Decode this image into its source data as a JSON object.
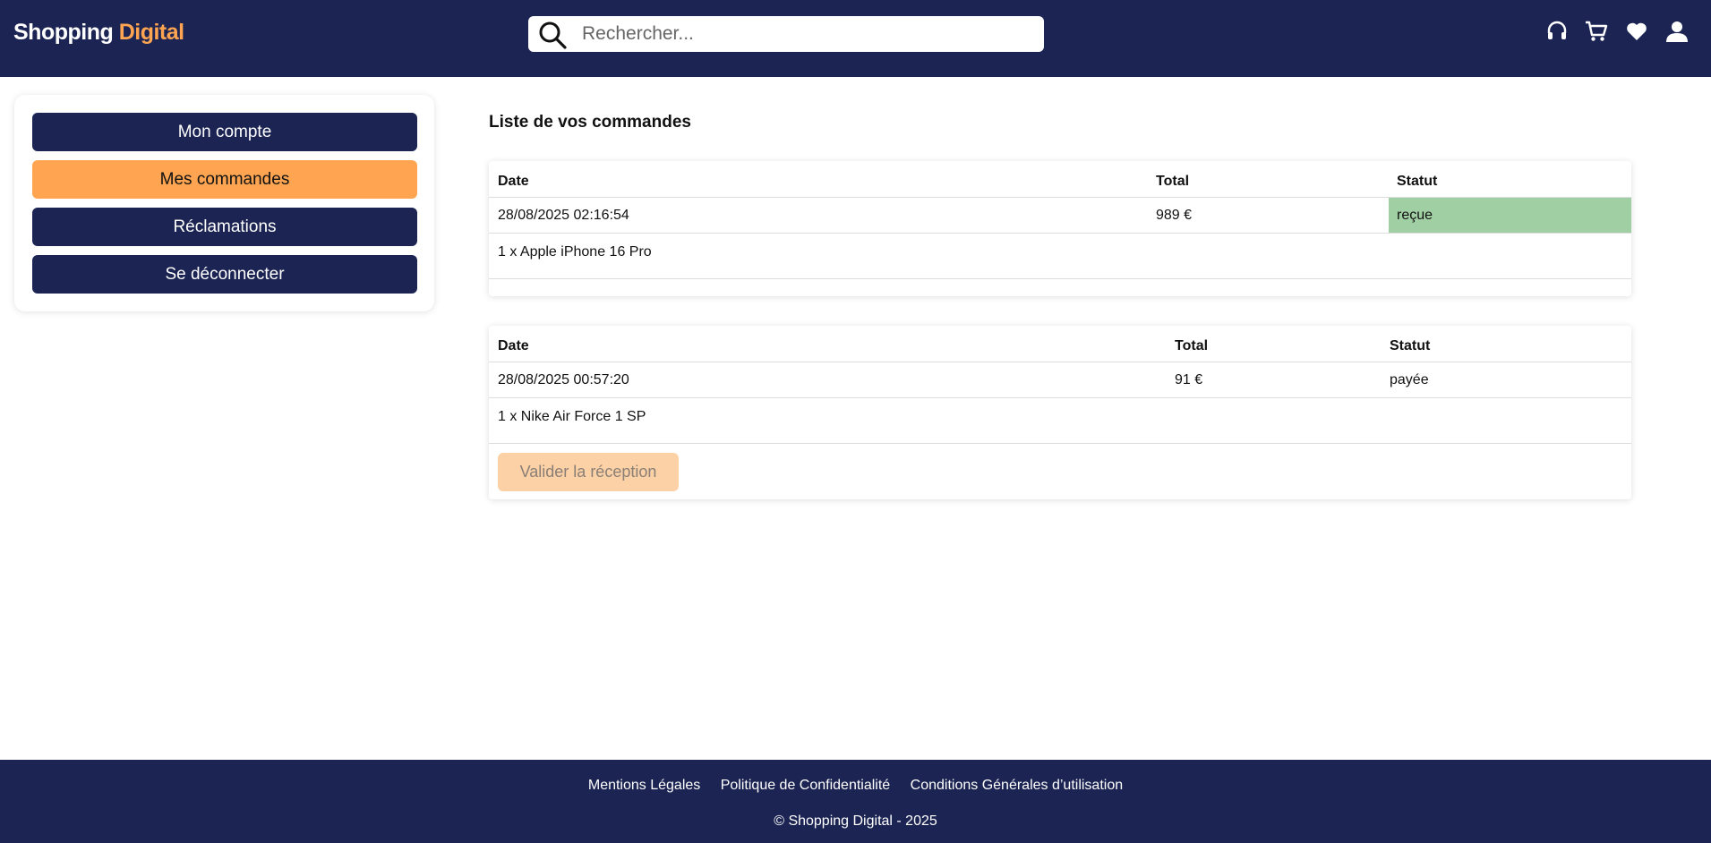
{
  "header": {
    "logo_main": "Shopping",
    "logo_accent": "Digital",
    "search_placeholder": "Rechercher...",
    "icons": [
      "headset-icon",
      "cart-icon",
      "heart-icon",
      "user-icon"
    ]
  },
  "sidebar": {
    "items": [
      {
        "label": "Mon compte",
        "active": false
      },
      {
        "label": "Mes commandes",
        "active": true
      },
      {
        "label": "Réclamations",
        "active": false
      },
      {
        "label": "Se déconnecter",
        "active": false
      }
    ]
  },
  "main": {
    "title": "Liste de vos commandes",
    "orders": [
      {
        "headers": {
          "date": "Date",
          "total": "Total",
          "status": "Statut"
        },
        "date": "28/08/2025 02:16:54",
        "total": "989 €",
        "status": "reçue",
        "status_color": "#a0cfa4",
        "items": "1 x Apple iPhone 16 Pro"
      },
      {
        "headers": {
          "date": "Date",
          "total": "Total",
          "status": "Statut"
        },
        "date": "28/08/2025 00:57:20",
        "total": "91 €",
        "status": "payée",
        "items": "1 x Nike Air Force 1 SP",
        "action_label": "Valider la réception"
      }
    ]
  },
  "footer": {
    "links": [
      "Mentions Légales",
      "Politique de Confidentialité",
      "Conditions Générales d’utilisation"
    ],
    "copyright": "© Shopping Digital - 2025"
  },
  "colors": {
    "navy": "#1b2452",
    "accent": "#ffa552",
    "status_received": "#a0cfa4",
    "disabled_button": "#fcd1a6"
  }
}
